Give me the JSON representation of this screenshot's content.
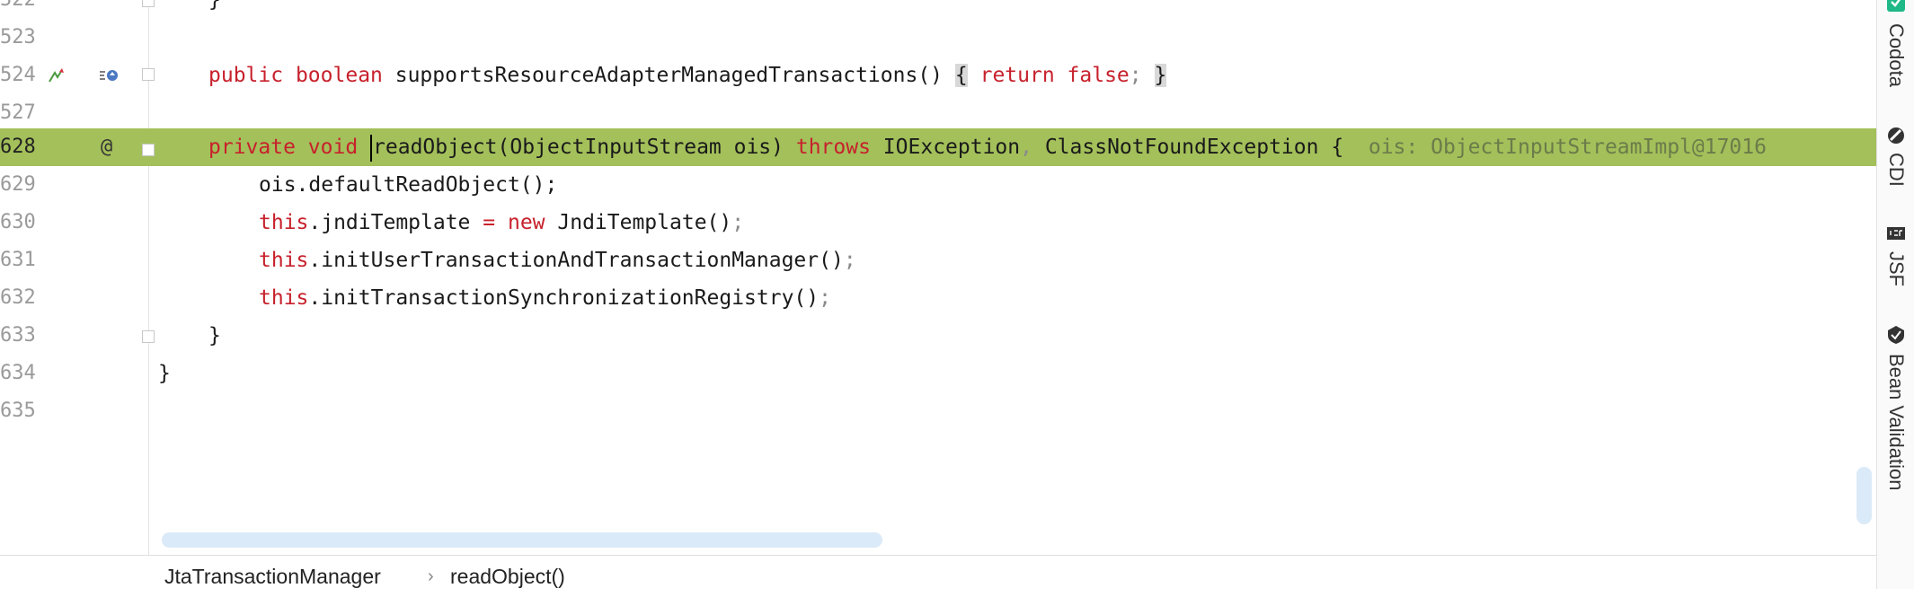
{
  "editor": {
    "lines": [
      {
        "num": "522",
        "code": "}"
      },
      {
        "num": "523",
        "code": ""
      },
      {
        "num": "524",
        "code": "public boolean supportsResourceAdapterManagedTransactions() { return false; }"
      },
      {
        "num": "527",
        "code": ""
      },
      {
        "num": "628",
        "code": "private void readObject(ObjectInputStream ois) throws IOException, ClassNotFoundException {",
        "inlay": "ois: ObjectInputStreamImpl@17016"
      },
      {
        "num": "629",
        "code": "ois.defaultReadObject();"
      },
      {
        "num": "630",
        "code": "this.jndiTemplate = new JndiTemplate();"
      },
      {
        "num": "631",
        "code": "this.initUserTransactionAndTransactionManager();"
      },
      {
        "num": "632",
        "code": "this.initTransactionSynchronizationRegistry();"
      },
      {
        "num": "633",
        "code": "}"
      },
      {
        "num": "634",
        "code": "}"
      },
      {
        "num": "635",
        "code": ""
      }
    ],
    "gutter_icons": {
      "line_524_a": "implemented-method-icon",
      "line_524_b": "overrides-icon",
      "line_628": "@"
    }
  },
  "breadcrumb": {
    "items": [
      "JtaTransactionManager",
      "readObject()"
    ],
    "separator": "›"
  },
  "right_toolbar": {
    "items": [
      "Codota",
      "CDI",
      "JSF",
      "Bean Validation"
    ]
  },
  "colors": {
    "highlight_line": "#a3c05a",
    "keyword": "#c7212c",
    "scrollbar": "#dbeaf8"
  }
}
